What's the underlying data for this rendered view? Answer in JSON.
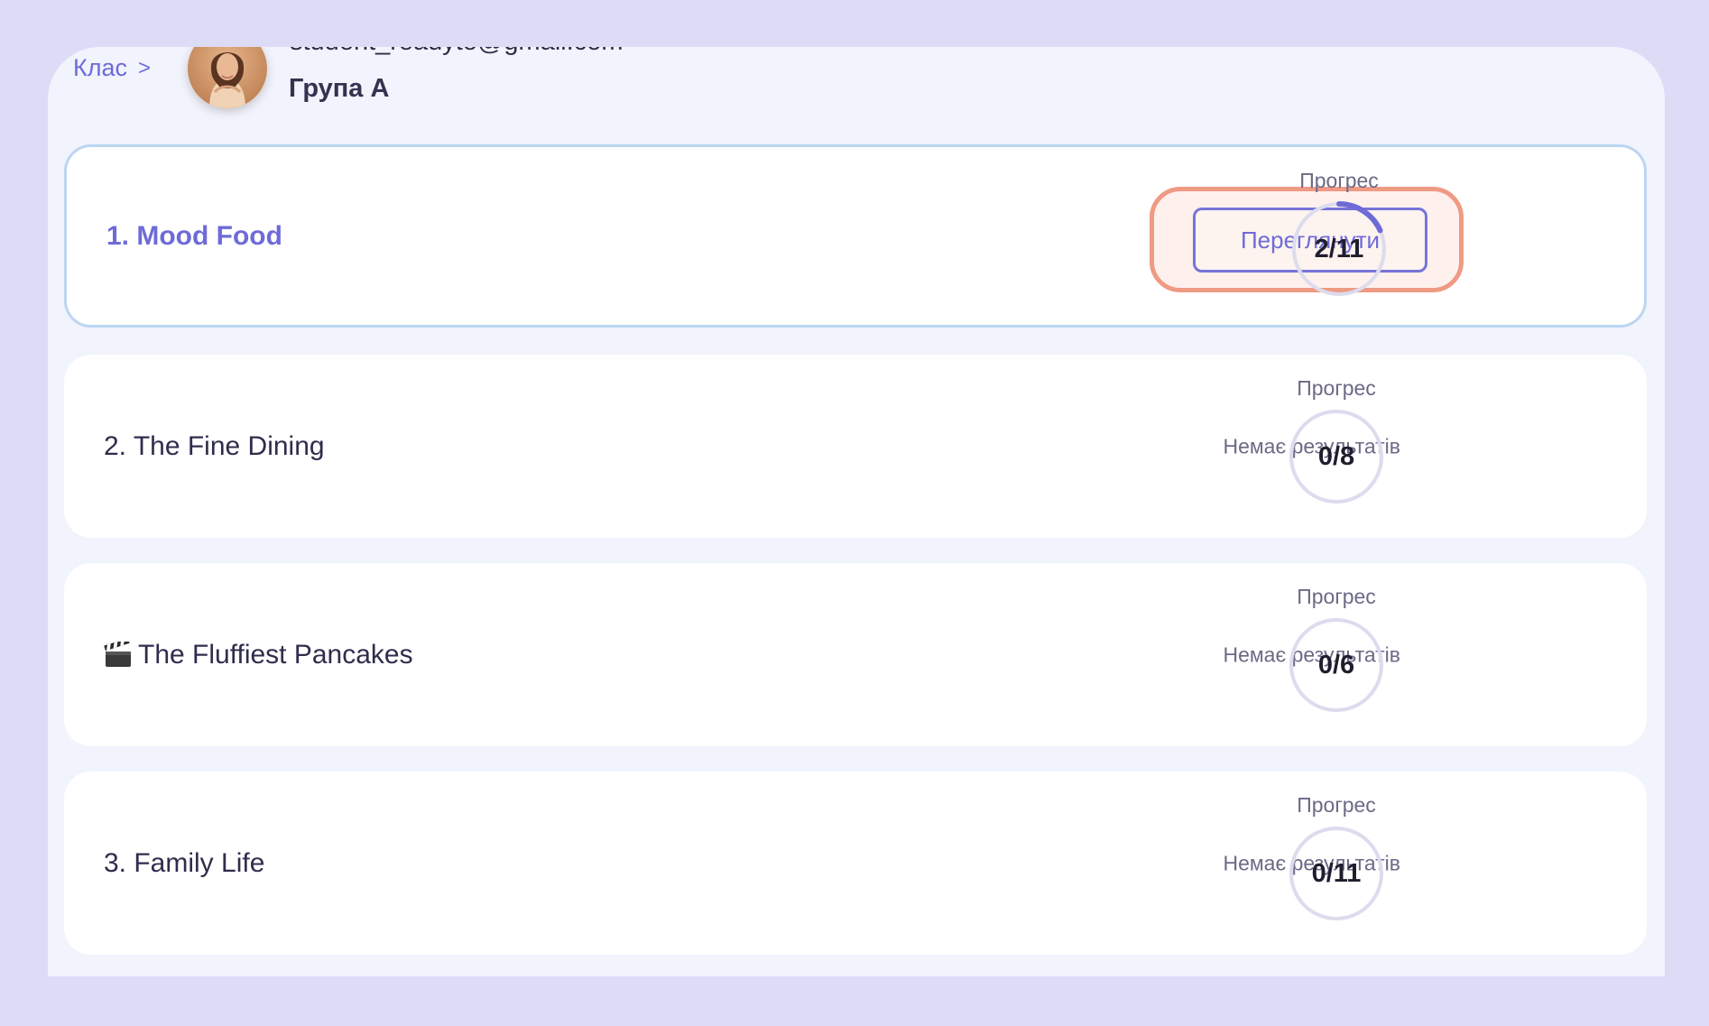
{
  "header": {
    "breadcrumb_label": "Клас",
    "breadcrumb_separator": ">",
    "email": "student_readyto@gmail.com",
    "group_name": "Група А"
  },
  "accent_color": "#6e6bd8",
  "highlight_color": "#ef9a84",
  "lessons": [
    {
      "title": "1. Mood Food",
      "action_label": "Переглянути",
      "progress_label": "Прогрес",
      "progress_text": "2/11",
      "progress_fraction": 0.1818
    },
    {
      "title": "2. The Fine Dining",
      "status_text": "Немає результатів",
      "progress_label": "Прогрес",
      "progress_text": "0/8",
      "progress_fraction": 0
    },
    {
      "title": "The Fluffiest Pancakes",
      "title_icon": "clapperboard-icon",
      "status_text": "Немає результатів",
      "progress_label": "Прогрес",
      "progress_text": "0/6",
      "progress_fraction": 0
    },
    {
      "title": "3. Family Life",
      "status_text": "Немає результатів",
      "progress_label": "Прогрес",
      "progress_text": "0/11",
      "progress_fraction": 0
    }
  ]
}
